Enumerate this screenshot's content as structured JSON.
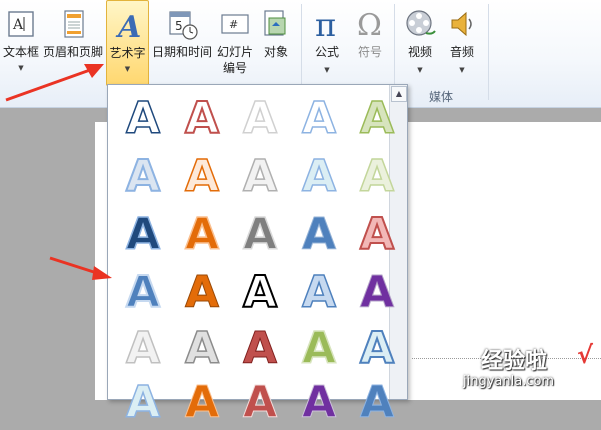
{
  "ribbon": {
    "buttons": [
      {
        "label": "文本框",
        "icon": "text-box-icon"
      },
      {
        "label": "页眉和页脚",
        "icon": "header-footer-icon"
      },
      {
        "label": "艺术字",
        "icon": "wordart-icon"
      },
      {
        "label": "日期和时间",
        "icon": "date-time-icon"
      },
      {
        "label": "幻灯片\n编号",
        "icon": "slide-number-icon"
      },
      {
        "label": "对象",
        "icon": "object-icon"
      },
      {
        "label": "公式",
        "icon": "pi-icon"
      },
      {
        "label": "符号",
        "icon": "omega-icon"
      },
      {
        "label": "视频",
        "icon": "film-reel-icon"
      },
      {
        "label": "音频",
        "icon": "speaker-icon"
      }
    ],
    "media_group_label": "媒体"
  },
  "gallery": {
    "letter": "A",
    "colors": {
      "blue": "#4f81bd",
      "red": "#c0504d",
      "gray": "#a6a6a6",
      "lightblue": "#8db3e2",
      "green": "#9bbb59",
      "orange": "#e36c09",
      "black": "#000000",
      "purple": "#7030a0",
      "darkblue": "#1f497d"
    }
  },
  "watermark": {
    "title": "经验啦",
    "check": "√",
    "url": "jingyanla.com"
  }
}
